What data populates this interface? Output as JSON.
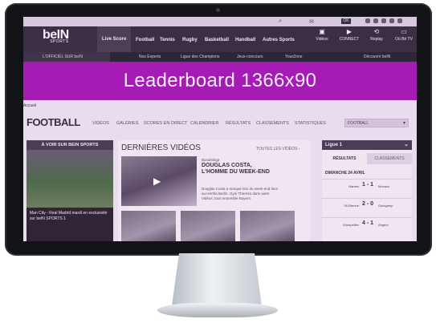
{
  "nav": {
    "logo_main": "beIN",
    "logo_sub": "SPORTS",
    "items": [
      "Live Score",
      "Football",
      "Tennis",
      "Rugby",
      "Basketball",
      "Handball",
      "Autres Sports"
    ],
    "tools": [
      {
        "label": "Vidéos",
        "icon": "video-icon"
      },
      {
        "label": "CONNECT",
        "icon": "play-icon"
      },
      {
        "label": "Replay",
        "icon": "replay-icon"
      },
      {
        "label": "Où Bé TV",
        "icon": "tv-icon"
      }
    ]
  },
  "subnav": {
    "promo": "L'OFFICIEL SUR beIN",
    "items": [
      "Nos Experts",
      "Ligue des Champions",
      "Jeux-concours",
      "YourZone"
    ],
    "discover": "Découvrir beIN"
  },
  "topbar": {
    "ok_label": "OK"
  },
  "leaderboard": {
    "label": "Leaderboard 1366x90"
  },
  "breadcrumb": "Accueil",
  "section": {
    "title": "FOOTBALL",
    "tabs": [
      "VIDÉOS",
      "GALERIES",
      "SCORES EN DIRECT",
      "CALENDRIER",
      "RÉSULTATS",
      "CLASSEMENTS",
      "STATISTIQUES"
    ],
    "dropdown": "FOOTBALL"
  },
  "left_card": {
    "header": "À VOIR SUR BEIN SPORTS",
    "caption": "Man City - Real Madrid mardi en exclusivité sur beIN SPORTS 1"
  },
  "videos": {
    "title": "DERNIÈRES VIDÉOS",
    "more": "TOUTES LES VIDÉOS ›",
    "tag": "Bundesliga",
    "headline": "DOUGLAS COSTA, L'HOMME DU WEEK-END",
    "description": "Douglas Costa a marqué lors du week-end face au Hertha Berlin. Gyni Theresa dans autre Vidéos, tous ensemble Bayern."
  },
  "right_panel": {
    "league": "Ligue 1",
    "tab_results": "RÉSULTATS",
    "tab_standings": "CLASSEMENTS",
    "day": "DIMANCHE 24 AVRIL",
    "matches": [
      {
        "home": "Nantes",
        "score": "1 - 1",
        "away": "Monaco"
      },
      {
        "home": "St-Etienne",
        "score": "2 - 0",
        "away": "Guingamp"
      },
      {
        "home": "Montpellier",
        "score": "4 - 1",
        "away": "Angers"
      }
    ]
  }
}
